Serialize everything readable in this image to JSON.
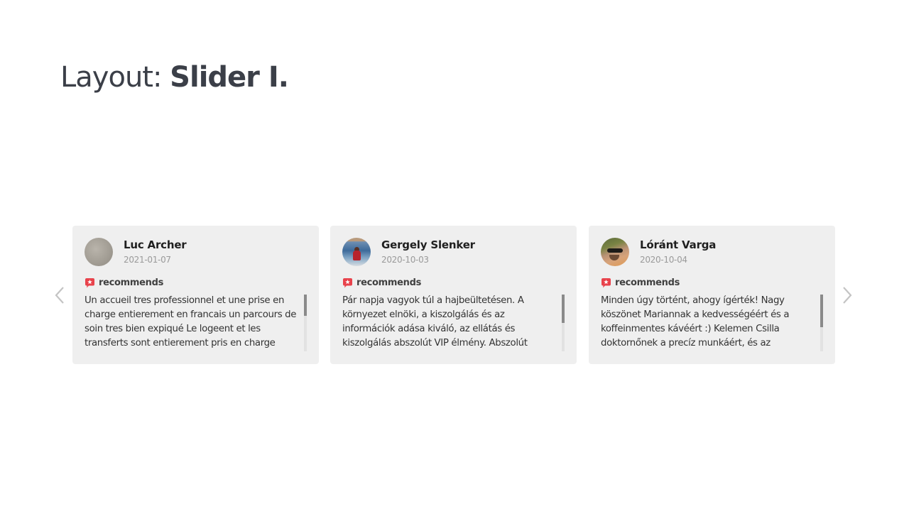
{
  "page": {
    "title_prefix": "Layout:",
    "title_bold": "Slider I."
  },
  "slider": {
    "prev_icon": "chevron-left-icon",
    "next_icon": "chevron-right-icon",
    "badge_color": "#e8424b",
    "reviews": [
      {
        "name": "Luc Archer",
        "date": "2021-01-07",
        "recommendation": "recommends",
        "text": "Un accueil tres professionnel et une prise en charge entierement en francais un parcours de soin tres bien expiqué Le logeent et les transferts sont entierement pris en charge",
        "scroll_fraction": 0.38
      },
      {
        "name": "Gergely Slenker",
        "date": "2020-10-03",
        "recommendation": "recommends",
        "text": "Pár napja vagyok túl a hajbeültetésen. A környezet elnöki, a kiszolgálás és az információk adása kiváló, az ellátás és kiszolgálás abszolút VIP élmény. Abszolút",
        "scroll_fraction": 0.5
      },
      {
        "name": "Lóránt Varga",
        "date": "2020-10-04",
        "recommendation": "recommends",
        "text": "Minden úgy történt, ahogy ígérték! Nagy köszönet Mariannak a kedvességéért és a koffeinmentes kávéért :) Kelemen Csilla doktornőnek a precíz munkáért, és az",
        "scroll_fraction": 0.58
      }
    ]
  }
}
